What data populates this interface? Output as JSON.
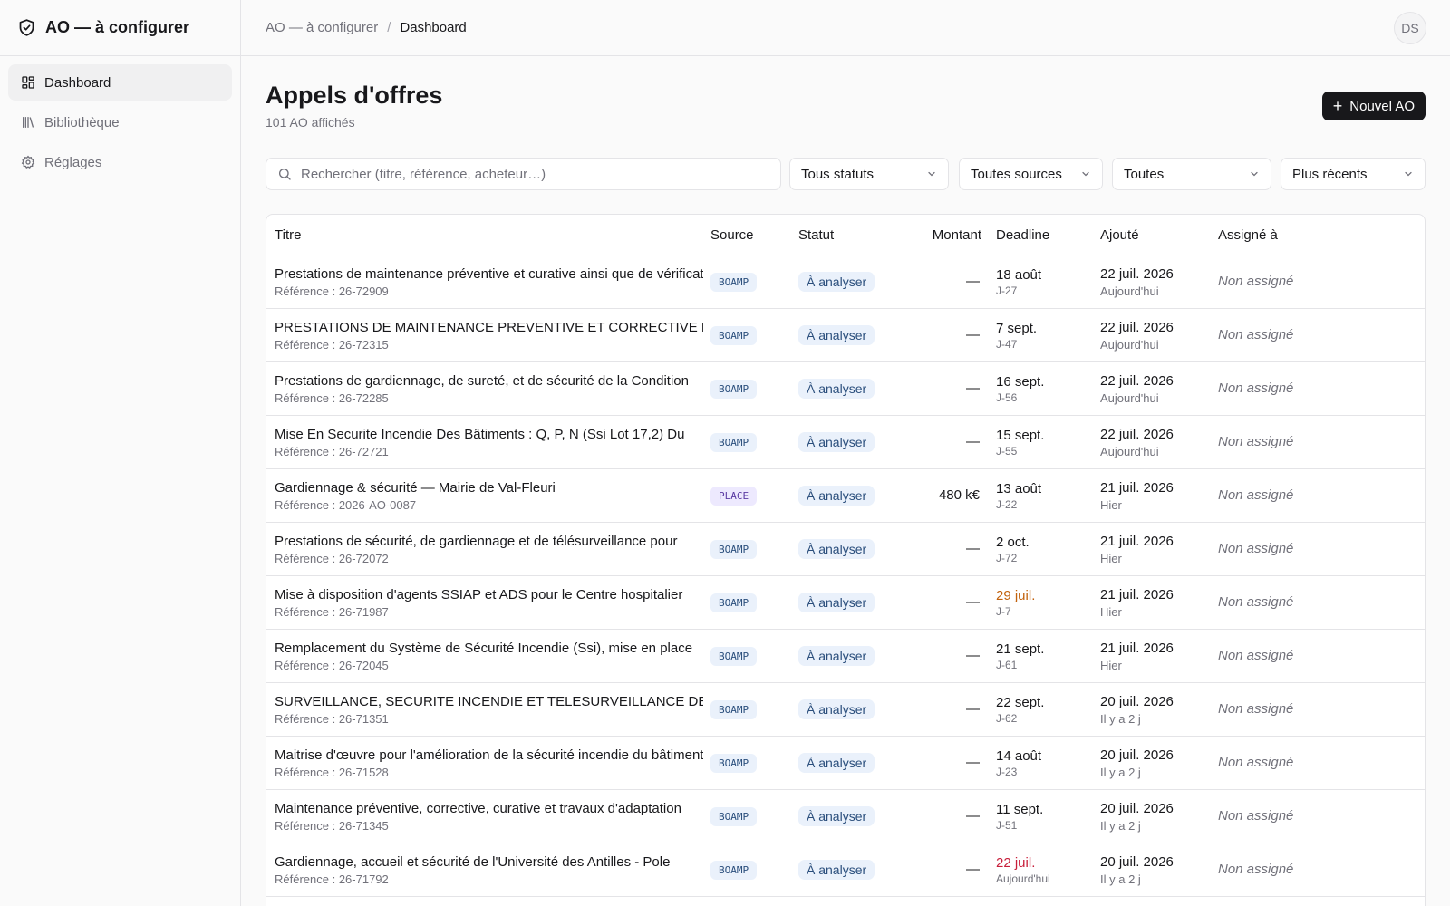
{
  "app": {
    "title": "AO — à configurer"
  },
  "sidebar": {
    "items": [
      {
        "label": "Dashboard",
        "icon": "dashboard-icon",
        "active": true
      },
      {
        "label": "Bibliothèque",
        "icon": "library-icon",
        "active": false
      },
      {
        "label": "Réglages",
        "icon": "gear-icon",
        "active": false
      }
    ]
  },
  "topbar": {
    "breadcrumb": [
      "AO — à configurer",
      "Dashboard"
    ],
    "separator": "/",
    "avatar": "DS"
  },
  "main": {
    "title": "Appels d'offres",
    "subtitle": "101 AO affichés",
    "new_button": "Nouvel AO"
  },
  "filters": {
    "search_placeholder": "Rechercher (titre, référence, acheteur…)",
    "status": "Tous statuts",
    "source": "Toutes sources",
    "third": "Toutes",
    "sort": "Plus récents"
  },
  "table": {
    "headers": {
      "title": "Titre",
      "source": "Source",
      "status": "Statut",
      "amount": "Montant",
      "deadline": "Deadline",
      "added": "Ajouté",
      "assigned": "Assigné à"
    },
    "rows": [
      {
        "title": "Prestations de maintenance préventive et curative ainsi que de vérifications",
        "ref": "Référence : 26-72909",
        "source": "BOAMP",
        "status": "À analyser",
        "amount": "—",
        "deadline": "18 août",
        "deadline_sub": "J-27",
        "deadline_level": "normal",
        "added": "22 juil. 2026",
        "added_sub": "Aujourd'hui",
        "assigned": "Non assigné"
      },
      {
        "title": "PRESTATIONS DE MAINTENANCE PREVENTIVE ET CORRECTIVE DES",
        "ref": "Référence : 26-72315",
        "source": "BOAMP",
        "status": "À analyser",
        "amount": "—",
        "deadline": "7 sept.",
        "deadline_sub": "J-47",
        "deadline_level": "normal",
        "added": "22 juil. 2026",
        "added_sub": "Aujourd'hui",
        "assigned": "Non assigné"
      },
      {
        "title": "Prestations de gardiennage, de sureté, et de sécurité de la Condition",
        "ref": "Référence : 26-72285",
        "source": "BOAMP",
        "status": "À analyser",
        "amount": "—",
        "deadline": "16 sept.",
        "deadline_sub": "J-56",
        "deadline_level": "normal",
        "added": "22 juil. 2026",
        "added_sub": "Aujourd'hui",
        "assigned": "Non assigné"
      },
      {
        "title": "Mise En Securite Incendie Des Bâtiments : Q, P, N (Ssi Lot 17,2) Du",
        "ref": "Référence : 26-72721",
        "source": "BOAMP",
        "status": "À analyser",
        "amount": "—",
        "deadline": "15 sept.",
        "deadline_sub": "J-55",
        "deadline_level": "normal",
        "added": "22 juil. 2026",
        "added_sub": "Aujourd'hui",
        "assigned": "Non assigné"
      },
      {
        "title": "Gardiennage & sécurité — Mairie de Val-Fleuri",
        "ref": "Référence : 2026-AO-0087",
        "source": "PLACE",
        "status": "À analyser",
        "amount": "480 k€",
        "deadline": "13 août",
        "deadline_sub": "J-22",
        "deadline_level": "normal",
        "added": "21 juil. 2026",
        "added_sub": "Hier",
        "assigned": "Non assigné"
      },
      {
        "title": "Prestations de sécurité, de gardiennage et de télésurveillance pour",
        "ref": "Référence : 26-72072",
        "source": "BOAMP",
        "status": "À analyser",
        "amount": "—",
        "deadline": "2 oct.",
        "deadline_sub": "J-72",
        "deadline_level": "normal",
        "added": "21 juil. 2026",
        "added_sub": "Hier",
        "assigned": "Non assigné"
      },
      {
        "title": "Mise à disposition d'agents SSIAP et ADS pour le Centre hospitalier",
        "ref": "Référence : 26-71987",
        "source": "BOAMP",
        "status": "À analyser",
        "amount": "—",
        "deadline": "29 juil.",
        "deadline_sub": "J-7",
        "deadline_level": "warn",
        "added": "21 juil. 2026",
        "added_sub": "Hier",
        "assigned": "Non assigné"
      },
      {
        "title": "Remplacement du Système de Sécurité Incendie (Ssi), mise en place",
        "ref": "Référence : 26-72045",
        "source": "BOAMP",
        "status": "À analyser",
        "amount": "—",
        "deadline": "21 sept.",
        "deadline_sub": "J-61",
        "deadline_level": "normal",
        "added": "21 juil. 2026",
        "added_sub": "Hier",
        "assigned": "Non assigné"
      },
      {
        "title": "SURVEILLANCE, SECURITE INCENDIE ET TELESURVEILLANCE DES",
        "ref": "Référence : 26-71351",
        "source": "BOAMP",
        "status": "À analyser",
        "amount": "—",
        "deadline": "22 sept.",
        "deadline_sub": "J-62",
        "deadline_level": "normal",
        "added": "20 juil. 2026",
        "added_sub": "Il y a 2 j",
        "assigned": "Non assigné"
      },
      {
        "title": "Maitrise d'œuvre pour l'amélioration de la sécurité incendie du bâtiment",
        "ref": "Référence : 26-71528",
        "source": "BOAMP",
        "status": "À analyser",
        "amount": "—",
        "deadline": "14 août",
        "deadline_sub": "J-23",
        "deadline_level": "normal",
        "added": "20 juil. 2026",
        "added_sub": "Il y a 2 j",
        "assigned": "Non assigné"
      },
      {
        "title": "Maintenance préventive, corrective, curative et travaux d'adaptation",
        "ref": "Référence : 26-71345",
        "source": "BOAMP",
        "status": "À analyser",
        "amount": "—",
        "deadline": "11 sept.",
        "deadline_sub": "J-51",
        "deadline_level": "normal",
        "added": "20 juil. 2026",
        "added_sub": "Il y a 2 j",
        "assigned": "Non assigné"
      },
      {
        "title": "Gardiennage, accueil et sécurité de l'Université des Antilles - Pole",
        "ref": "Référence : 26-71792",
        "source": "BOAMP",
        "status": "À analyser",
        "amount": "—",
        "deadline": "22 juil.",
        "deadline_sub": "Aujourd'hui",
        "deadline_level": "urgent",
        "added": "20 juil. 2026",
        "added_sub": "Il y a 2 j",
        "assigned": "Non assigné"
      }
    ]
  }
}
